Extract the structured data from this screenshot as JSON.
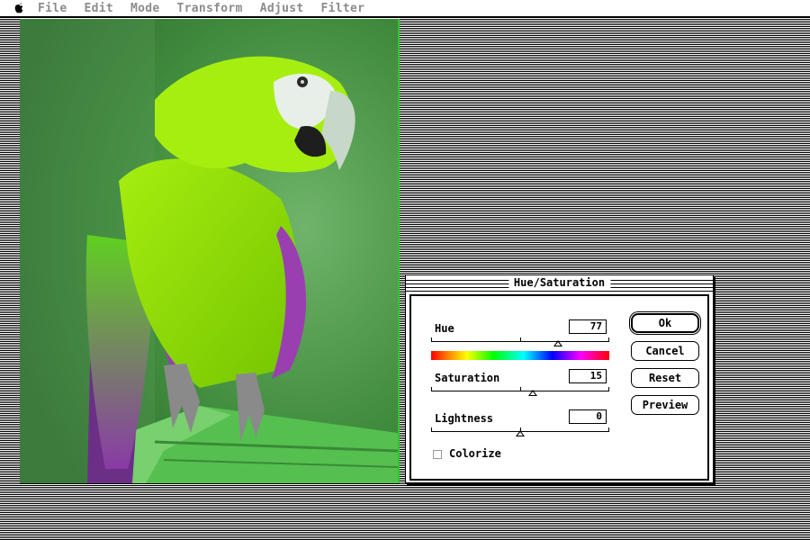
{
  "menubar": {
    "apple_icon": "apple-icon",
    "items": [
      "File",
      "Edit",
      "Mode",
      "Transform",
      "Adjust",
      "Filter"
    ]
  },
  "canvas": {
    "image_subject": "parrot-photo",
    "colors": {
      "bird": "#8fe000",
      "background": "#3f8a3d",
      "wing": "#9a3fb0",
      "perch": "#55c050"
    }
  },
  "dialog": {
    "title": "Hue/Saturation",
    "hue": {
      "label": "Hue",
      "value": "77",
      "level": 0.71
    },
    "saturation": {
      "label": "Saturation",
      "value": "15",
      "level": 0.57
    },
    "lightness": {
      "label": "Lightness",
      "value": "0",
      "level": 0.5
    },
    "colorize": {
      "label": "Colorize",
      "checked": false
    },
    "buttons": {
      "ok": "Ok",
      "cancel": "Cancel",
      "reset": "Reset",
      "preview": "Preview"
    }
  }
}
